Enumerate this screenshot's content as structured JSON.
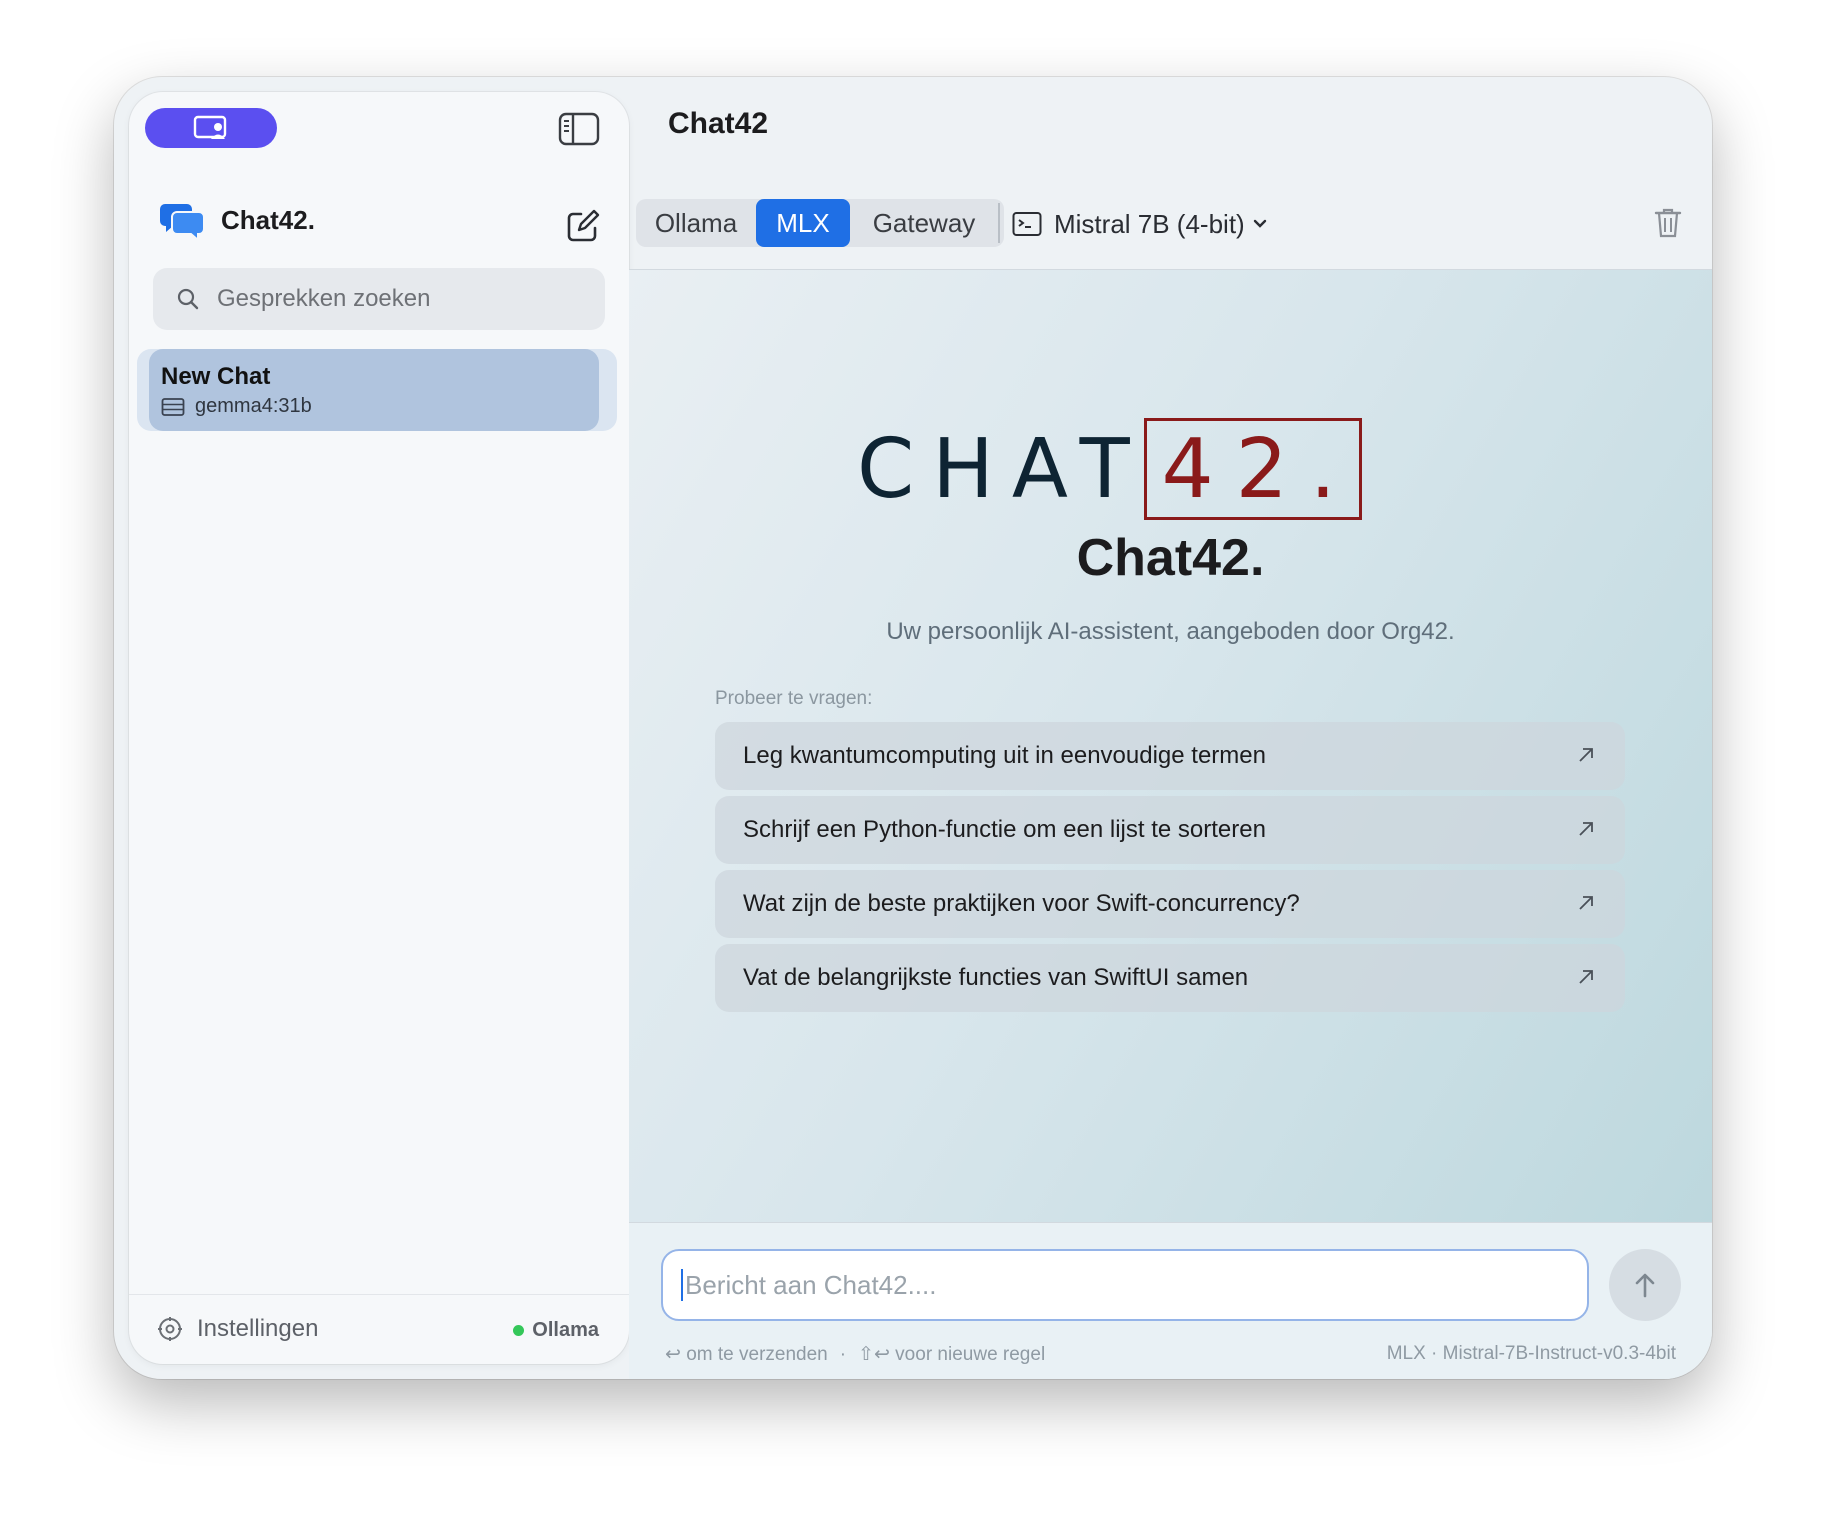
{
  "sidebar": {
    "brand_name": "Chat42.",
    "search_placeholder": "Gesprekken zoeken",
    "chats": [
      {
        "title": "New Chat",
        "model": "gemma4:31b"
      }
    ],
    "settings_label": "Instellingen",
    "status_label": "Ollama"
  },
  "header": {
    "title": "Chat42",
    "providers": [
      "Ollama",
      "MLX",
      "Gateway"
    ],
    "active_provider": "MLX",
    "model_label": "Mistral 7B (4-bit)"
  },
  "welcome": {
    "logo_word": "CHAT",
    "logo_number": "42.",
    "title": "Chat42.",
    "subtitle": "Uw persoonlijk AI-assistent, aangeboden door Org42.",
    "try_label": "Probeer te vragen:",
    "suggestions": [
      "Leg kwantumcomputing uit in eenvoudige termen",
      "Schrijf een Python-functie om een lijst te sorteren",
      "Wat zijn de beste praktijken voor Swift-concurrency?",
      "Vat de belangrijkste functies van SwiftUI samen"
    ]
  },
  "composer": {
    "placeholder": "Bericht aan Chat42....",
    "hint_send": "↩ om te verzenden",
    "hint_separator": "·",
    "hint_newline": "⇧↩ voor nieuwe regel",
    "model_info": "MLX · Mistral-7B-Instruct-v0.3-4bit"
  },
  "colors": {
    "accent": "#1f6fe5",
    "sidebar_pill": "#5b4ff0",
    "selected_chat": "#b0c4de",
    "logo_red": "#8a1a1a",
    "status_green": "#34c759"
  }
}
